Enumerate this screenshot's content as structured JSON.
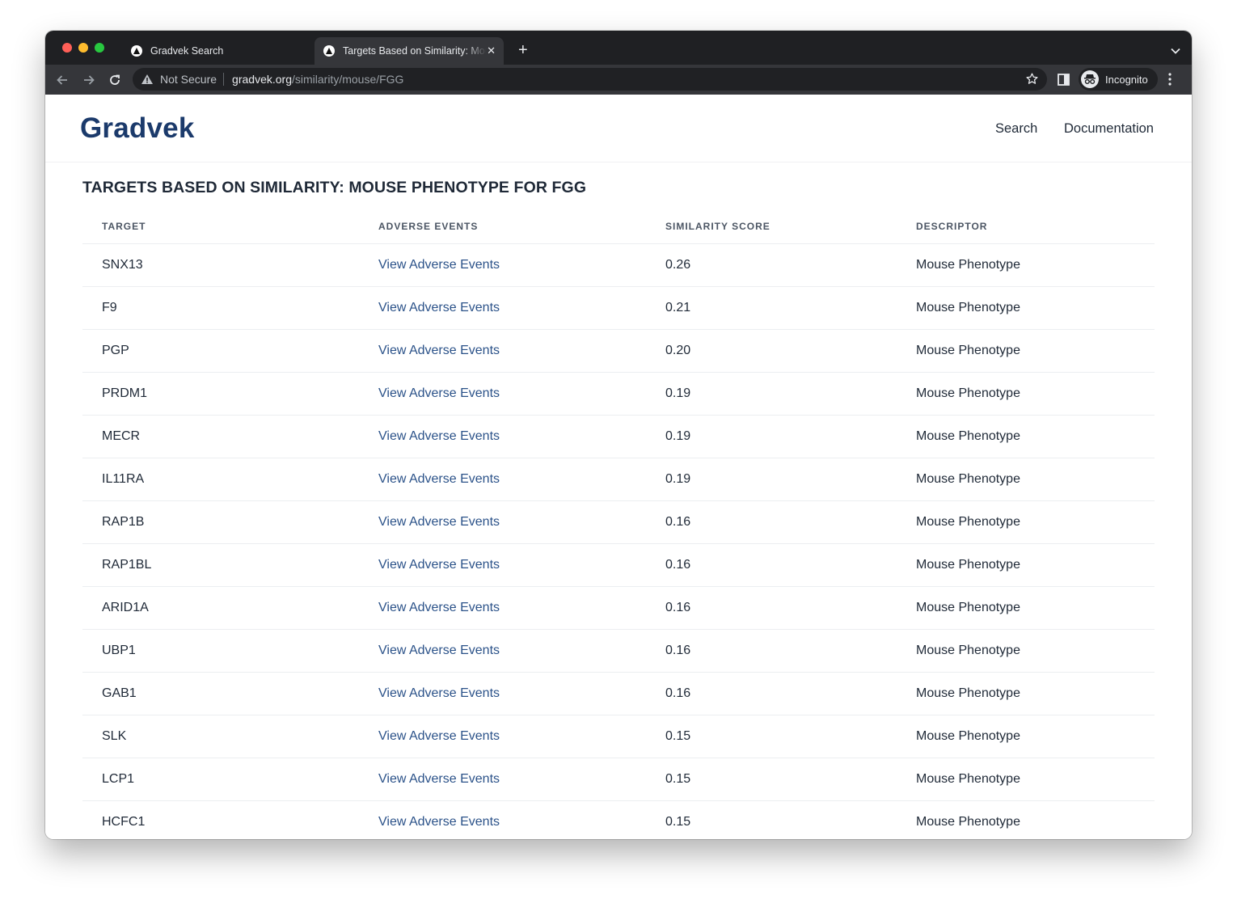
{
  "browser": {
    "tabs": [
      {
        "title": "Gradvek Search",
        "active": false
      },
      {
        "title": "Targets Based on Similarity: Mouse Phenotype",
        "active": true
      }
    ],
    "new_tab_symbol": "+",
    "close_symbol": "✕",
    "security_label": "Not Secure",
    "url_host": "gradvek.org",
    "url_path": "/similarity/mouse/FGG",
    "profile_label": "Incognito"
  },
  "site": {
    "logo": "Gradvek",
    "nav": [
      {
        "label": "Search"
      },
      {
        "label": "Documentation"
      }
    ]
  },
  "main": {
    "title": "TARGETS BASED ON SIMILARITY: MOUSE PHENOTYPE FOR FGG",
    "table": {
      "columns": [
        "TARGET",
        "ADVERSE EVENTS",
        "SIMILARITY SCORE",
        "DESCRIPTOR"
      ],
      "rows": [
        {
          "target": "SNX13",
          "link": "View Adverse Events",
          "score": "0.26",
          "descriptor": "Mouse Phenotype"
        },
        {
          "target": "F9",
          "link": "View Adverse Events",
          "score": "0.21",
          "descriptor": "Mouse Phenotype"
        },
        {
          "target": "PGP",
          "link": "View Adverse Events",
          "score": "0.20",
          "descriptor": "Mouse Phenotype"
        },
        {
          "target": "PRDM1",
          "link": "View Adverse Events",
          "score": "0.19",
          "descriptor": "Mouse Phenotype"
        },
        {
          "target": "MECR",
          "link": "View Adverse Events",
          "score": "0.19",
          "descriptor": "Mouse Phenotype"
        },
        {
          "target": "IL11RA",
          "link": "View Adverse Events",
          "score": "0.19",
          "descriptor": "Mouse Phenotype"
        },
        {
          "target": "RAP1B",
          "link": "View Adverse Events",
          "score": "0.16",
          "descriptor": "Mouse Phenotype"
        },
        {
          "target": "RAP1BL",
          "link": "View Adverse Events",
          "score": "0.16",
          "descriptor": "Mouse Phenotype"
        },
        {
          "target": "ARID1A",
          "link": "View Adverse Events",
          "score": "0.16",
          "descriptor": "Mouse Phenotype"
        },
        {
          "target": "UBP1",
          "link": "View Adverse Events",
          "score": "0.16",
          "descriptor": "Mouse Phenotype"
        },
        {
          "target": "GAB1",
          "link": "View Adverse Events",
          "score": "0.16",
          "descriptor": "Mouse Phenotype"
        },
        {
          "target": "SLK",
          "link": "View Adverse Events",
          "score": "0.15",
          "descriptor": "Mouse Phenotype"
        },
        {
          "target": "LCP1",
          "link": "View Adverse Events",
          "score": "0.15",
          "descriptor": "Mouse Phenotype"
        },
        {
          "target": "HCFC1",
          "link": "View Adverse Events",
          "score": "0.15",
          "descriptor": "Mouse Phenotype"
        }
      ]
    }
  },
  "colors": {
    "logo": "#1b3a6b",
    "link": "#2b5289",
    "chrome_dark": "#1f2023",
    "chrome_toolbar": "#35363a"
  }
}
